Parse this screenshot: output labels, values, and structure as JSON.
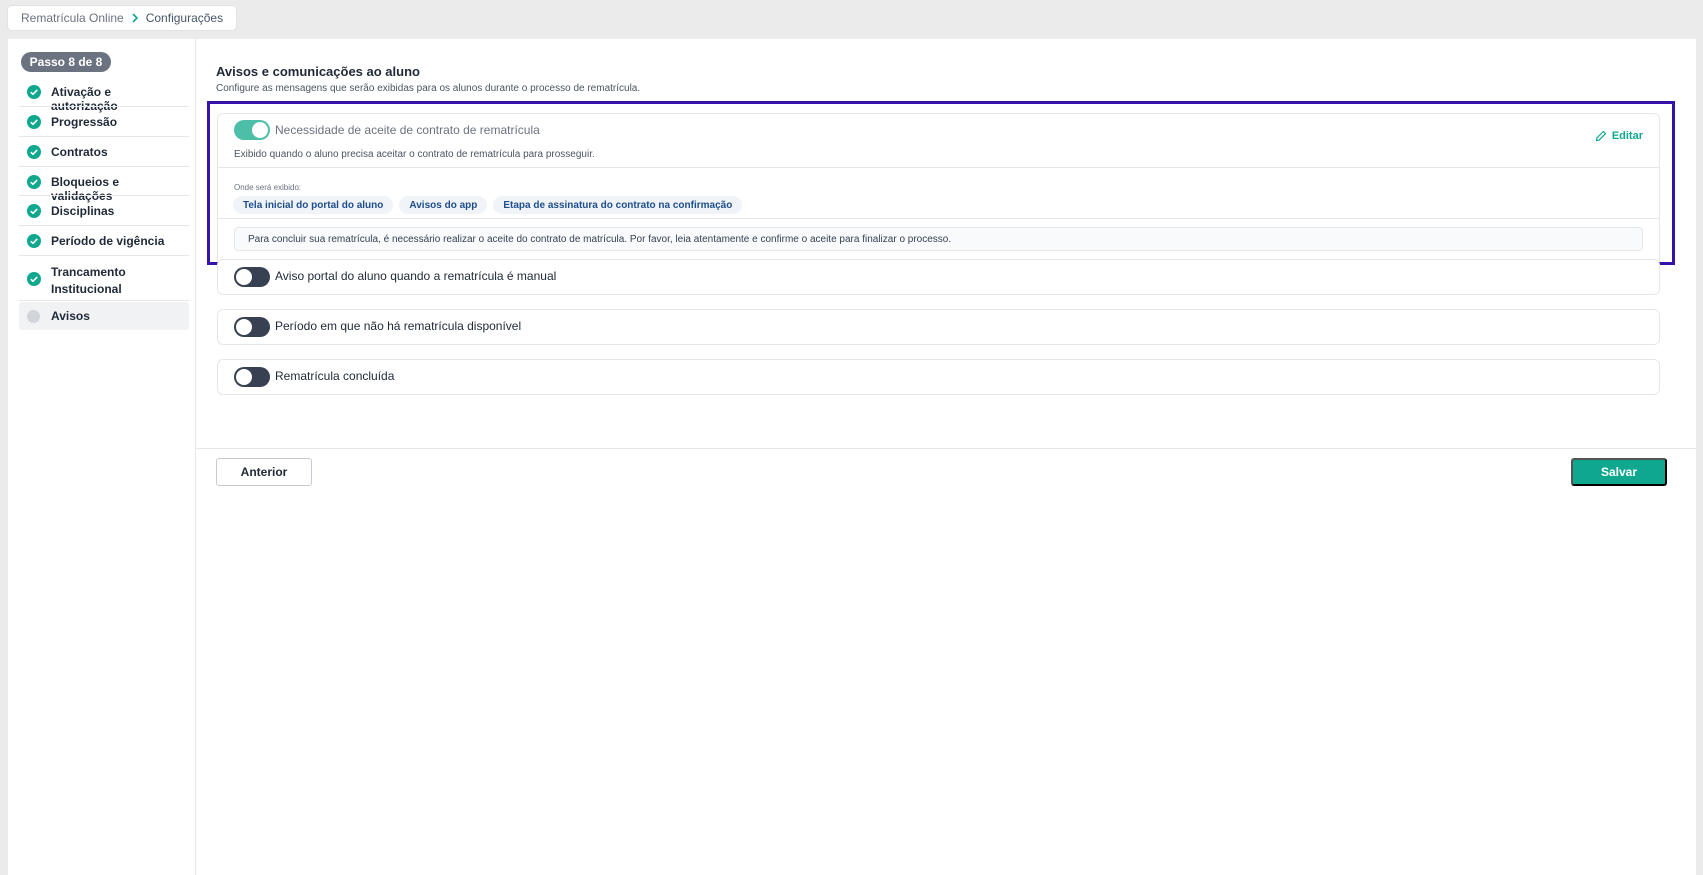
{
  "breadcrumb": {
    "items": [
      "Rematrícula Online",
      "Configurações"
    ]
  },
  "sidebar": {
    "step_badge": "Passo 8 de 8",
    "items": [
      {
        "label": "Ativação e autorização",
        "status": "done"
      },
      {
        "label": "Progressão",
        "status": "done"
      },
      {
        "label": "Contratos",
        "status": "done"
      },
      {
        "label": "Bloqueios e validações",
        "status": "done"
      },
      {
        "label": "Disciplinas",
        "status": "done"
      },
      {
        "label": "Período de vigência",
        "status": "done"
      },
      {
        "label": "Trancamento Institucional",
        "status": "done"
      },
      {
        "label": "Avisos",
        "status": "current"
      }
    ]
  },
  "main": {
    "title": "Avisos e comunicações ao aluno",
    "subtitle": "Configure as mensagens que serão exibidas para os alunos durante o processo de rematrícula.",
    "notices": [
      {
        "title": "Necessidade de aceite de contrato de rematrícula",
        "enabled": true,
        "edit_label": "Editar",
        "description": "Exibido quando o aluno precisa aceitar o contrato de rematrícula para prosseguir.",
        "where_label": "Onde será exibido:",
        "locations": [
          "Tela inicial do portal do aluno",
          "Avisos do app",
          "Etapa de assinatura do contrato na confirmação"
        ],
        "message": "Para concluir sua rematrícula, é necessário realizar o aceite do contrato de matrícula. Por favor, leia atentamente e confirme o aceite para finalizar o processo."
      },
      {
        "title": "Aviso portal do aluno quando a rematrícula é manual",
        "enabled": false
      },
      {
        "title": "Período em que não há rematrícula disponível",
        "enabled": false
      },
      {
        "title": "Rematrícula concluída",
        "enabled": false
      }
    ]
  },
  "footer": {
    "prev_label": "Anterior",
    "save_label": "Salvar"
  },
  "colors": {
    "accent": "#0fa88f",
    "highlight_border": "#3512a8",
    "toggle_off": "#374151",
    "toggle_on": "#4dbfa8"
  }
}
